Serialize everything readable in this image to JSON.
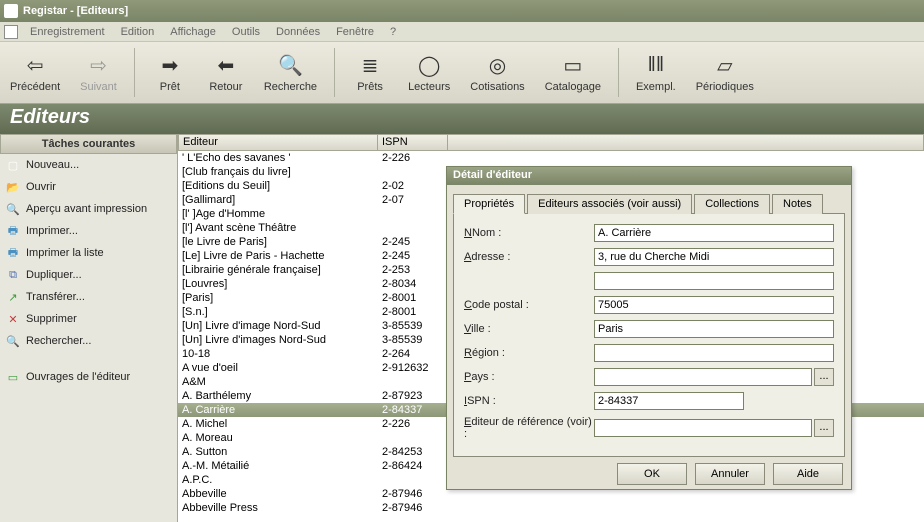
{
  "window_title": "Registar  -  [Editeurs]",
  "menu": [
    "Enregistrement",
    "Edition",
    "Affichage",
    "Outils",
    "Données",
    "Fenêtre",
    "?"
  ],
  "toolbar": [
    {
      "label": "Précédent",
      "icon": "⇦",
      "name": "back-button"
    },
    {
      "label": "Suivant",
      "icon": "⇨",
      "name": "forward-button",
      "disabled": true
    },
    {
      "label": "Prêt",
      "icon": "➡",
      "name": "loan-button"
    },
    {
      "label": "Retour",
      "icon": "⬅",
      "name": "return-button"
    },
    {
      "label": "Recherche",
      "icon": "🔍",
      "name": "search-button"
    },
    {
      "label": "Prêts",
      "icon": "≣",
      "name": "loans-button"
    },
    {
      "label": "Lecteurs",
      "icon": "◯",
      "name": "readers-button"
    },
    {
      "label": "Cotisations",
      "icon": "◎",
      "name": "dues-button"
    },
    {
      "label": "Catalogage",
      "icon": "▭",
      "name": "catalog-button"
    },
    {
      "label": "Exempl.",
      "icon": "‖‖",
      "name": "copies-button"
    },
    {
      "label": "Périodiques",
      "icon": "▱",
      "name": "periodicals-button"
    }
  ],
  "page_header": "Editeurs",
  "sidebar": {
    "header": "Tâches courantes",
    "items": [
      {
        "label": "Nouveau...",
        "name": "sidebar-new",
        "icon": "▢",
        "color": "#fff"
      },
      {
        "label": "Ouvrir",
        "name": "sidebar-open",
        "icon": "📂",
        "color": "#e6b84a"
      },
      {
        "label": "Aperçu avant impression",
        "name": "sidebar-preview",
        "icon": "🔍",
        "color": "#4a6ab0"
      },
      {
        "label": "Imprimer...",
        "name": "sidebar-print",
        "icon": "🖶",
        "color": "#4a90c0"
      },
      {
        "label": "Imprimer la liste",
        "name": "sidebar-print-list",
        "icon": "🖶",
        "color": "#4a90c0"
      },
      {
        "label": "Dupliquer...",
        "name": "sidebar-duplicate",
        "icon": "⧉",
        "color": "#4a6ab0"
      },
      {
        "label": "Transférer...",
        "name": "sidebar-transfer",
        "icon": "↗",
        "color": "#3a9a3a"
      },
      {
        "label": "Supprimer",
        "name": "sidebar-delete",
        "icon": "✕",
        "color": "#c04040"
      },
      {
        "label": "Rechercher...",
        "name": "sidebar-search",
        "icon": "🔍",
        "color": "#888"
      }
    ],
    "items2": [
      {
        "label": "Ouvrages de l'éditeur",
        "name": "sidebar-works",
        "icon": "▭",
        "color": "#3a9a3a"
      }
    ]
  },
  "grid": {
    "columns": [
      "Editeur",
      "ISPN"
    ],
    "rows": [
      {
        "editeur": "' L'Echo des savanes '",
        "ispn": "2-226"
      },
      {
        "editeur": "[Club français du livre]",
        "ispn": ""
      },
      {
        "editeur": "[Editions du Seuil]",
        "ispn": "2-02"
      },
      {
        "editeur": "[Gallimard]",
        "ispn": "2-07"
      },
      {
        "editeur": "[l' ]Age d'Homme",
        "ispn": ""
      },
      {
        "editeur": "[l'] Avant scène Théâtre",
        "ispn": ""
      },
      {
        "editeur": "[le Livre de Paris]",
        "ispn": "2-245"
      },
      {
        "editeur": "[Le] Livre de Paris - Hachette",
        "ispn": "2-245"
      },
      {
        "editeur": "[Librairie générale française]",
        "ispn": "2-253"
      },
      {
        "editeur": "[Louvres]",
        "ispn": "2-8034"
      },
      {
        "editeur": "[Paris]",
        "ispn": "2-8001"
      },
      {
        "editeur": "[S.n.]",
        "ispn": "2-8001"
      },
      {
        "editeur": "[Un] Livre d'image Nord-Sud",
        "ispn": "3-85539"
      },
      {
        "editeur": "[Un] Livre d'images Nord-Sud",
        "ispn": "3-85539"
      },
      {
        "editeur": "10-18",
        "ispn": "2-264"
      },
      {
        "editeur": "A vue d'oeil",
        "ispn": "2-912632"
      },
      {
        "editeur": "A&M",
        "ispn": ""
      },
      {
        "editeur": "A. Barthélemy",
        "ispn": "2-87923"
      },
      {
        "editeur": "A. Carrière",
        "ispn": "2-84337",
        "selected": true
      },
      {
        "editeur": "A. Michel",
        "ispn": "2-226"
      },
      {
        "editeur": "A. Moreau",
        "ispn": ""
      },
      {
        "editeur": "A. Sutton",
        "ispn": "2-84253"
      },
      {
        "editeur": "A.-M. Métailié",
        "ispn": "2-86424"
      },
      {
        "editeur": "A.P.C.",
        "ispn": ""
      },
      {
        "editeur": "Abbeville",
        "ispn": "2-87946"
      },
      {
        "editeur": "Abbeville Press",
        "ispn": "2-87946"
      }
    ]
  },
  "dialog": {
    "title": "Détail d'éditeur",
    "tabs": [
      "Propriétés",
      "Editeurs associés (voir aussi)",
      "Collections",
      "Notes"
    ],
    "fields": {
      "nom_label": "Nom :",
      "nom": "A. Carrière",
      "adresse_label": "Adresse :",
      "adresse": "3, rue du Cherche Midi",
      "adresse2": "",
      "cp_label": "Code postal :",
      "cp": "75005",
      "ville_label": "Ville :",
      "ville": "Paris",
      "region_label": "Région :",
      "region": "",
      "pays_label": "Pays :",
      "pays": "",
      "ispn_label": "ISPN :",
      "ispn": "2-84337",
      "ref_label": "Editeur de référence (voir) :",
      "ref": ""
    },
    "buttons": {
      "ok": "OK",
      "cancel": "Annuler",
      "help": "Aide"
    }
  }
}
